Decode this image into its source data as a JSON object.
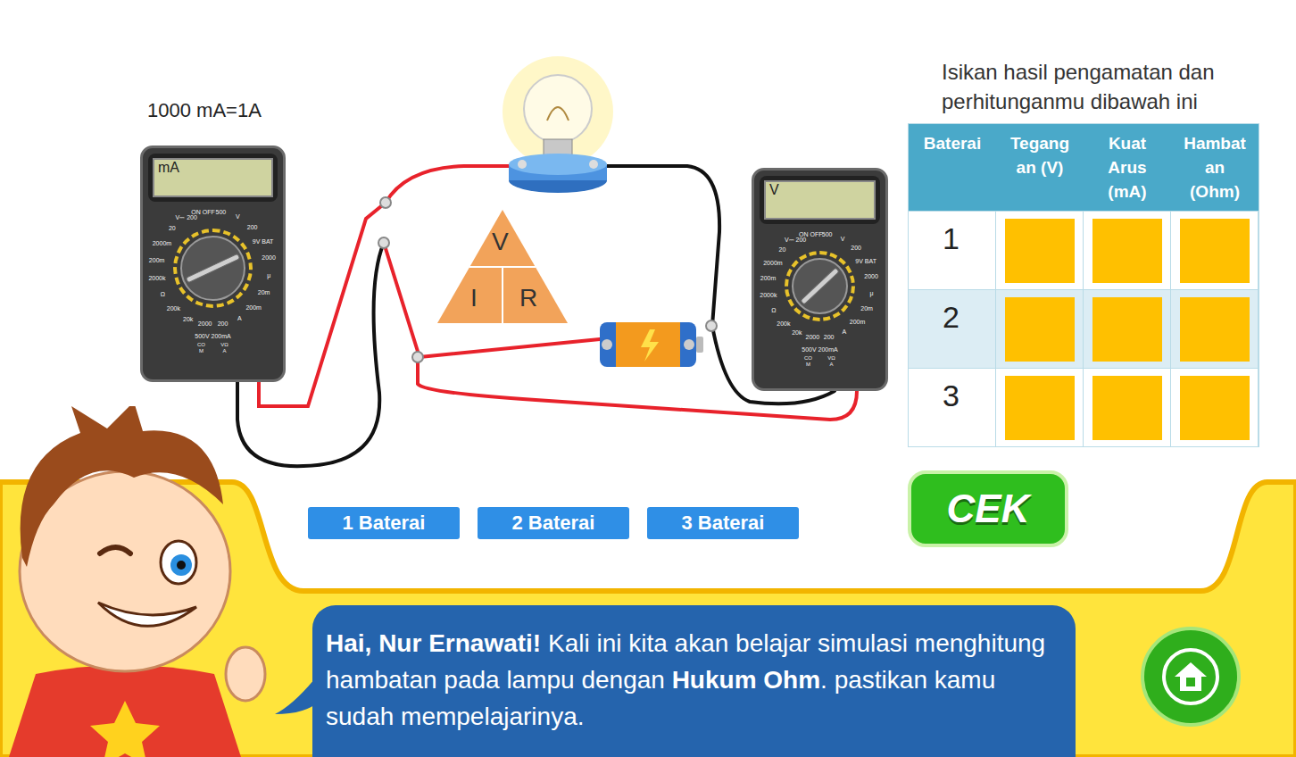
{
  "hint": "1000 mA=1A",
  "meters": [
    {
      "display": "mA",
      "level": 0.18,
      "labels": [
        "ON OFF",
        "500",
        "V",
        "200",
        "9V BAT",
        "2000",
        "μ",
        "20m",
        "200m",
        "A",
        "200",
        "2000",
        "20k",
        "200k",
        "Ω",
        "2000k",
        "200m",
        "2000m",
        "20",
        "V⎓ 200"
      ],
      "footer": "500V 200mA",
      "jacks": [
        "COM",
        "VΩA"
      ]
    },
    {
      "display": "V",
      "level": 0.13,
      "labels": [
        "ON OFF",
        "500",
        "V",
        "200",
        "9V BAT",
        "2000",
        "μ",
        "20m",
        "200m",
        "A",
        "200",
        "2000",
        "20k",
        "200k",
        "Ω",
        "2000k",
        "200m",
        "2000m",
        "20",
        "V⎓ 200"
      ],
      "footer": "500V 200mA",
      "jacks": [
        "COM",
        "VΩA"
      ]
    }
  ],
  "lamp": {
    "on": true
  },
  "triangle": {
    "top": "V",
    "left": "I",
    "right": "R"
  },
  "battery_buttons": [
    {
      "label": "1 Baterai",
      "selected": false
    },
    {
      "label": "2 Baterai",
      "selected": false
    },
    {
      "label": "3 Baterai",
      "selected": false
    }
  ],
  "table": {
    "title": [
      "Isikan hasil pengamatan dan",
      "perhitunganmu dibawah ini"
    ],
    "columns": [
      [
        "Baterai"
      ],
      [
        "Tegang",
        "an (V)"
      ],
      [
        "Kuat",
        "Arus",
        "(mA)"
      ],
      [
        "Hambat",
        "an",
        "(Ohm)"
      ]
    ],
    "rows": [
      {
        "label": "1",
        "cells": [
          "",
          "",
          ""
        ]
      },
      {
        "label": "2",
        "cells": [
          "",
          "",
          ""
        ]
      },
      {
        "label": "3",
        "cells": [
          "",
          "",
          ""
        ]
      }
    ]
  },
  "check_button": "CEK",
  "message": [
    {
      "text": "Hai, Nur Ernawati!",
      "bold": true
    },
    {
      "text": " Kali ini kita akan belajar simulasi menghitung hambatan pada lampu dengan ",
      "bold": false
    },
    {
      "text": "Hukum Ohm",
      "bold": true
    },
    {
      "text": ". pastikan kamu sudah mempelajarinya.",
      "bold": false
    }
  ]
}
